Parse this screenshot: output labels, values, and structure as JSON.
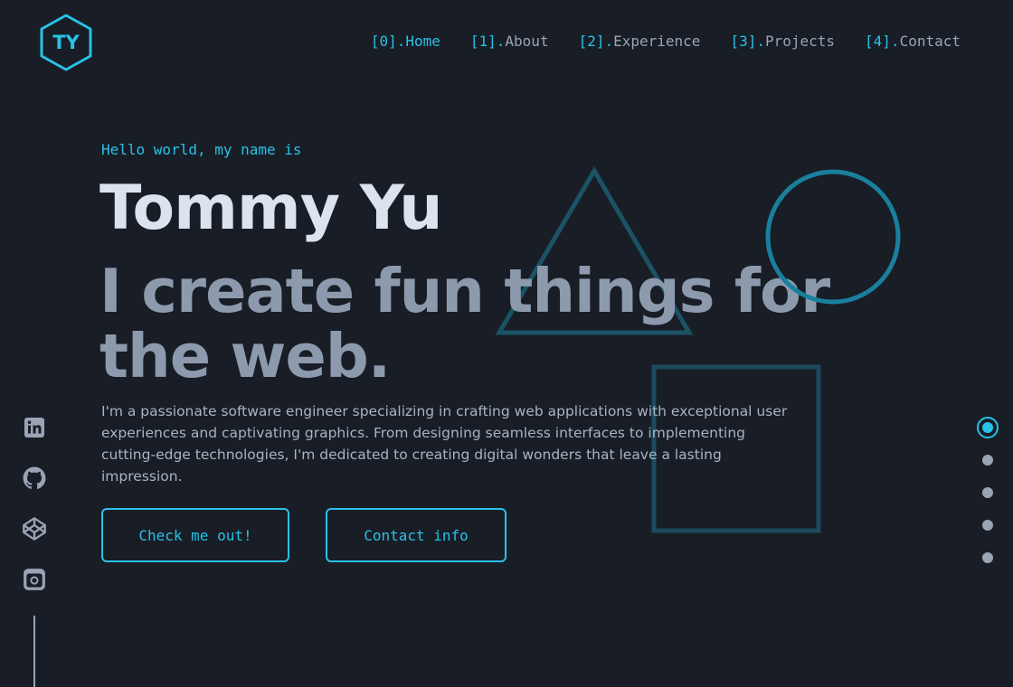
{
  "logo": {
    "initials": "TY"
  },
  "nav": [
    {
      "num": "[0].",
      "label": "Home",
      "active": true
    },
    {
      "num": "[1].",
      "label": "About",
      "active": false
    },
    {
      "num": "[2].",
      "label": "Experience",
      "active": false
    },
    {
      "num": "[3].",
      "label": "Projects",
      "active": false
    },
    {
      "num": "[4].",
      "label": "Contact",
      "active": false
    }
  ],
  "hero": {
    "greeting": "Hello world, my name is",
    "name": "Tommy Yu",
    "tagline": "I create fun things for the web.",
    "description": "I'm a passionate software engineer specializing in crafting web applications with exceptional user experiences and captivating graphics. From designing seamless interfaces to implementing cutting-edge technologies, I'm dedicated to creating digital wonders that leave a lasting impression.",
    "buttons": {
      "primary": "Check me out!",
      "secondary": "Contact info"
    }
  },
  "social_icons": [
    "linkedin-icon",
    "github-icon",
    "codepen-icon",
    "instagram-icon"
  ],
  "section_dots": {
    "count": 5,
    "active_index": 0
  },
  "colors": {
    "background": "#181d26",
    "accent": "#28c2e6",
    "heading": "#dbe3ee",
    "tagline": "#8d9aad",
    "body_text": "#a9b4c3",
    "muted": "#9aa4b5"
  }
}
